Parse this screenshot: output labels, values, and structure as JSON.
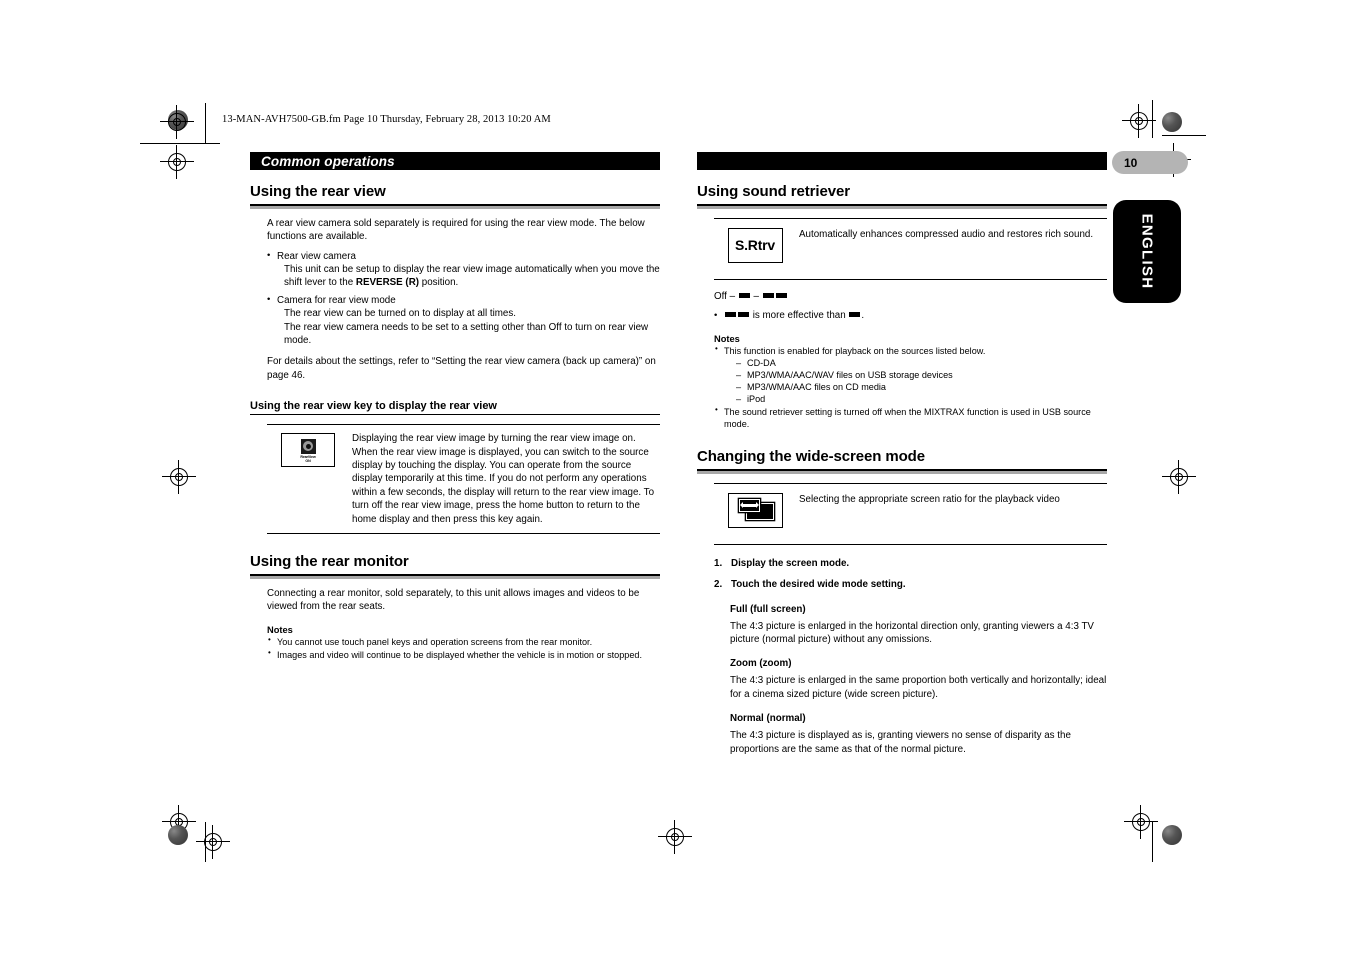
{
  "document": {
    "fm_line": "13-MAN-AVH7500-GB.fm  Page 10  Thursday, February 28, 2013  10:20 AM",
    "page_number": "10",
    "language_tab": "ENGLISH",
    "running_head": "Common operations"
  },
  "left_column": {
    "h1": "Using the rear view",
    "intro": "A rear view camera sold separately is required for using the rear view mode. The below functions are available.",
    "bullets": [
      {
        "title": "Rear view camera",
        "lines": [
          "This unit can be setup to display the rear view image automatically when you move the shift lever to the "
        ],
        "bold": "REVERSE (R)",
        "tail": " position."
      },
      {
        "title": "Camera for rear view mode",
        "line1": "The rear view can be turned on to display at all times.",
        "line2": "The rear view camera needs to be set to a setting other than Off to turn on rear view mode."
      }
    ],
    "details": "For details about the settings, refer to “Setting the rear view camera (back up camera)” on page 46.",
    "h2": "Using the rear view key to display the rear view",
    "key_icon": {
      "name": "rearview-on-key",
      "caption_line1": "RearView",
      "caption_line2": "ON"
    },
    "key_desc": "Displaying the rear view image by turning the rear view image on. When the rear view image is displayed, you can switch to the source display by touching the display. You can operate from the source display temporarily at this time. If you do not perform any operations within a few seconds, the display will return to the rear view image. To turn off the rear view image, press the home button to return to the home display and then press this key again.",
    "h1_monitor": "Using the rear monitor",
    "monitor_intro": "Connecting a rear monitor, sold separately, to this unit allows images and videos to be viewed from the rear seats.",
    "notes_label": "Notes",
    "monitor_notes": [
      "You cannot use touch panel keys and operation screens from the rear monitor.",
      "Images and video will continue to be displayed whether the vehicle is in motion or stopped."
    ]
  },
  "right_column": {
    "h1_retriever": "Using sound retriever",
    "retriever_key_label": "S.Rtrv",
    "retriever_desc": "Automatically enhances compressed audio and restores rich sound.",
    "level_prefix": "Off – ",
    "level_sep": " – ",
    "effective_mid": " is more effective than ",
    "effective_end": ".",
    "notes_label": "Notes",
    "retriever_notes_1": "This function is enabled for playback on the sources listed below.",
    "retriever_sources": [
      "CD-DA",
      "MP3/WMA/AAC/WAV files on USB storage devices",
      "MP3/WMA/AAC files on CD media",
      "iPod"
    ],
    "retriever_notes_2": "The sound retriever setting is turned off when the MIXTRAX function is used in USB source mode.",
    "h1_widescreen": "Changing the wide-screen mode",
    "widescreen_key_name": "wide-screen-mode-key",
    "widescreen_desc": "Selecting the appropriate screen ratio for the playback video",
    "steps": [
      "Display the screen mode.",
      "Touch the desired wide mode setting."
    ],
    "modes": [
      {
        "term": "Full (full screen)",
        "body": "The 4:3 picture is enlarged in the horizontal direction only, granting viewers a 4:3 TV picture (normal picture) without any omissions."
      },
      {
        "term": "Zoom (zoom)",
        "body": "The 4:3 picture is enlarged in the same proportion both vertically and horizontally; ideal for a cinema sized picture (wide screen picture)."
      },
      {
        "term": "Normal (normal)",
        "body": "The 4:3 picture is displayed as is, granting viewers no sense of disparity as the proportions are the same as that of the normal picture."
      }
    ]
  }
}
